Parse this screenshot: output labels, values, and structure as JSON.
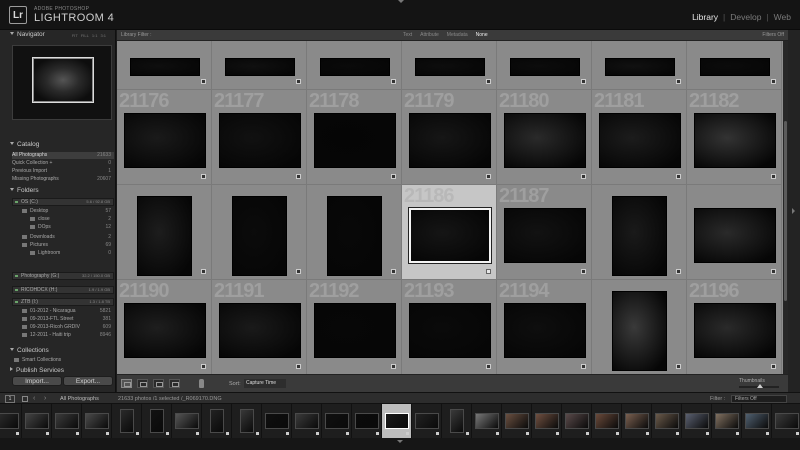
{
  "header": {
    "logo": "Lr",
    "app_subtitle": "ADOBE PHOTOSHOP",
    "app_name": "LIGHTROOM 4",
    "modules": [
      "Library",
      "Develop",
      "Web"
    ],
    "module_separator": "|",
    "active_module": "Library"
  },
  "navigator": {
    "title": "Navigator",
    "modes": [
      "FIT",
      "FILL",
      "1:1",
      "3:1"
    ]
  },
  "catalog": {
    "title": "Catalog",
    "items": [
      {
        "label": "All Photographs",
        "count": "21633"
      },
      {
        "label": "Quick Collection +",
        "count": "0"
      },
      {
        "label": "Previous Import",
        "count": "1"
      },
      {
        "label": "Missing Photographs",
        "count": "20607"
      }
    ]
  },
  "folders": {
    "title": "Folders",
    "volumes": [
      {
        "label": "OS (C:)",
        "capacity": "5.6 / 92.8 GB"
      },
      {
        "label": "Photography (G:)",
        "capacity": "32.2 / 150.0 GB"
      },
      {
        "label": "RICOHDCX (H:)",
        "capacity": "1.9 / 1.9 GB"
      },
      {
        "label": "ZTB (I:)",
        "capacity": "1.3 / 1.8 TB"
      }
    ],
    "os_folders": [
      {
        "label": "Desktop",
        "count": "57"
      },
      {
        "label": "close",
        "count": "2"
      },
      {
        "label": "DOps",
        "count": "12"
      },
      {
        "label": "Downloads",
        "count": "2"
      },
      {
        "label": "Pictures",
        "count": "69"
      },
      {
        "label": "Lightroom",
        "count": "0"
      }
    ],
    "ztb_folders": [
      {
        "label": "01-2012 - Nicaragua",
        "count": "5821"
      },
      {
        "label": "09-2013-FTL Street",
        "count": "381"
      },
      {
        "label": "09-2013-Ricoh GRDIV",
        "count": "609"
      },
      {
        "label": "12-2011 - Haiti trip",
        "count": "8946"
      }
    ]
  },
  "collections": {
    "title": "Collections",
    "items": [
      "Smart Collections"
    ]
  },
  "publish": {
    "title": "Publish Services"
  },
  "buttons": {
    "import": "Import...",
    "export": "Export..."
  },
  "library_filter": {
    "label": "Library Filter :",
    "options": [
      "Text",
      "Attribute",
      "Metadata",
      "None"
    ],
    "active": "None",
    "custom": "Filters Off"
  },
  "grid": {
    "selected_index": 17,
    "cells": [
      {
        "num": "",
        "pw": 70,
        "ph": 18,
        "py": 0,
        "tone": "#0e0e0e"
      },
      {
        "num": "",
        "pw": 70,
        "ph": 18,
        "py": 0,
        "tone": "#101010"
      },
      {
        "num": "",
        "pw": 70,
        "ph": 18,
        "py": 0,
        "tone": "#0a0a0a"
      },
      {
        "num": "",
        "pw": 70,
        "ph": 18,
        "py": 0,
        "tone": "#0d0d0d"
      },
      {
        "num": "",
        "pw": 70,
        "ph": 18,
        "py": 0,
        "tone": "#0c0c0c"
      },
      {
        "num": "",
        "pw": 70,
        "ph": 18,
        "py": 0,
        "tone": "#111111"
      },
      {
        "num": "",
        "pw": 70,
        "ph": 18,
        "py": 0,
        "tone": "#0b0b0b"
      },
      {
        "num": "21176",
        "pw": 82,
        "ph": 55,
        "tone": "#1a1a1a"
      },
      {
        "num": "21177",
        "pw": 82,
        "ph": 55,
        "tone": "#111111"
      },
      {
        "num": "21178",
        "pw": 82,
        "ph": 55,
        "tone": "#050505"
      },
      {
        "num": "21179",
        "pw": 82,
        "ph": 55,
        "tone": "#161616"
      },
      {
        "num": "21180",
        "pw": 82,
        "ph": 55,
        "tone": "#2a2a2a"
      },
      {
        "num": "21181",
        "pw": 82,
        "ph": 55,
        "tone": "#1c1c1c"
      },
      {
        "num": "21182",
        "pw": 82,
        "ph": 55,
        "tone": "#333333"
      },
      {
        "num": "",
        "pw": 55,
        "ph": 80,
        "tone": "#1d1d1d"
      },
      {
        "num": "",
        "pw": 55,
        "ph": 80,
        "tone": "#0b0b0b"
      },
      {
        "num": "",
        "pw": 55,
        "ph": 80,
        "tone": "#080808"
      },
      {
        "num": "21186",
        "pw": 82,
        "ph": 55,
        "tone": "#151515"
      },
      {
        "num": "21187",
        "pw": 82,
        "ph": 55,
        "tone": "#121212"
      },
      {
        "num": "",
        "pw": 55,
        "ph": 80,
        "tone": "#1a1a1a"
      },
      {
        "num": "",
        "pw": 82,
        "ph": 55,
        "tone": "#2a2a2a"
      },
      {
        "num": "21190",
        "pw": 82,
        "ph": 55,
        "tone": "#1e1e1e"
      },
      {
        "num": "21191",
        "pw": 82,
        "ph": 55,
        "tone": "#1a1a1a"
      },
      {
        "num": "21192",
        "pw": 82,
        "ph": 55,
        "tone": "#070707"
      },
      {
        "num": "21193",
        "pw": 82,
        "ph": 55,
        "tone": "#0a0a0a"
      },
      {
        "num": "21194",
        "pw": 82,
        "ph": 55,
        "tone": "#0e0e0e"
      },
      {
        "num": "",
        "pw": 55,
        "ph": 80,
        "tone": "#3a3a3a"
      },
      {
        "num": "21196",
        "pw": 82,
        "ph": 55,
        "tone": "#2a2a2a"
      },
      {
        "num": "",
        "pw": 82,
        "ph": 55,
        "tone": "#0e0e0e"
      },
      {
        "num": "",
        "pw": 82,
        "ph": 55,
        "tone": "#0e0e0e"
      },
      {
        "num": "",
        "pw": 82,
        "ph": 55,
        "tone": "#0e0e0e"
      },
      {
        "num": "",
        "pw": 82,
        "ph": 55,
        "tone": "#0e0e0e"
      },
      {
        "num": "",
        "pw": 82,
        "ph": 55,
        "tone": "#0e0e0e"
      },
      {
        "num": "",
        "pw": 82,
        "ph": 55,
        "tone": "#0e0e0e"
      },
      {
        "num": "",
        "pw": 82,
        "ph": 55,
        "tone": "#0e0e0e"
      }
    ]
  },
  "toolbar": {
    "sort_label": "Sort:",
    "sort_value": "Capture Time",
    "thumbnails_label": "Thumbnails"
  },
  "filmstrip": {
    "page": "1",
    "source": "All Photographs",
    "count_text": "21633 photos /1 selected /_R069170.DNG",
    "filter_label": "Filter :",
    "filter_value": "Filters Off",
    "selected_index": 13,
    "thumbs": [
      {
        "landscape": true,
        "tone": "#2e2e2e"
      },
      {
        "landscape": true,
        "tone": "#444444"
      },
      {
        "landscape": true,
        "tone": "#3b3b3b"
      },
      {
        "landscape": true,
        "tone": "#4a4a4a"
      },
      {
        "landscape": false,
        "tone": "#2a2a2a"
      },
      {
        "landscape": false,
        "tone": "#121212"
      },
      {
        "landscape": true,
        "tone": "#555555"
      },
      {
        "landscape": false,
        "tone": "#222222"
      },
      {
        "landscape": false,
        "tone": "#383838"
      },
      {
        "landscape": true,
        "tone": "#0f0f0f"
      },
      {
        "landscape": true,
        "tone": "#3a3a3a"
      },
      {
        "landscape": true,
        "tone": "#101010"
      },
      {
        "landscape": true,
        "tone": "#0b0b0b"
      },
      {
        "landscape": true,
        "tone": "#1a1a1a"
      },
      {
        "landscape": true,
        "tone": "#222222"
      },
      {
        "landscape": false,
        "tone": "#3a3a3a"
      },
      {
        "landscape": true,
        "tone": "#777777"
      },
      {
        "landscape": true,
        "tone": "#6a5040"
      },
      {
        "landscape": true,
        "tone": "#705040"
      },
      {
        "landscape": true,
        "tone": "#5a4a4a"
      },
      {
        "landscape": true,
        "tone": "#6a4a3a"
      },
      {
        "landscape": true,
        "tone": "#7a6050"
      },
      {
        "landscape": true,
        "tone": "#6a5a4a"
      },
      {
        "landscape": true,
        "tone": "#5a6070"
      },
      {
        "landscape": true,
        "tone": "#807060"
      },
      {
        "landscape": true,
        "tone": "#506070"
      },
      {
        "landscape": true,
        "tone": "#3a3a3a"
      }
    ]
  }
}
